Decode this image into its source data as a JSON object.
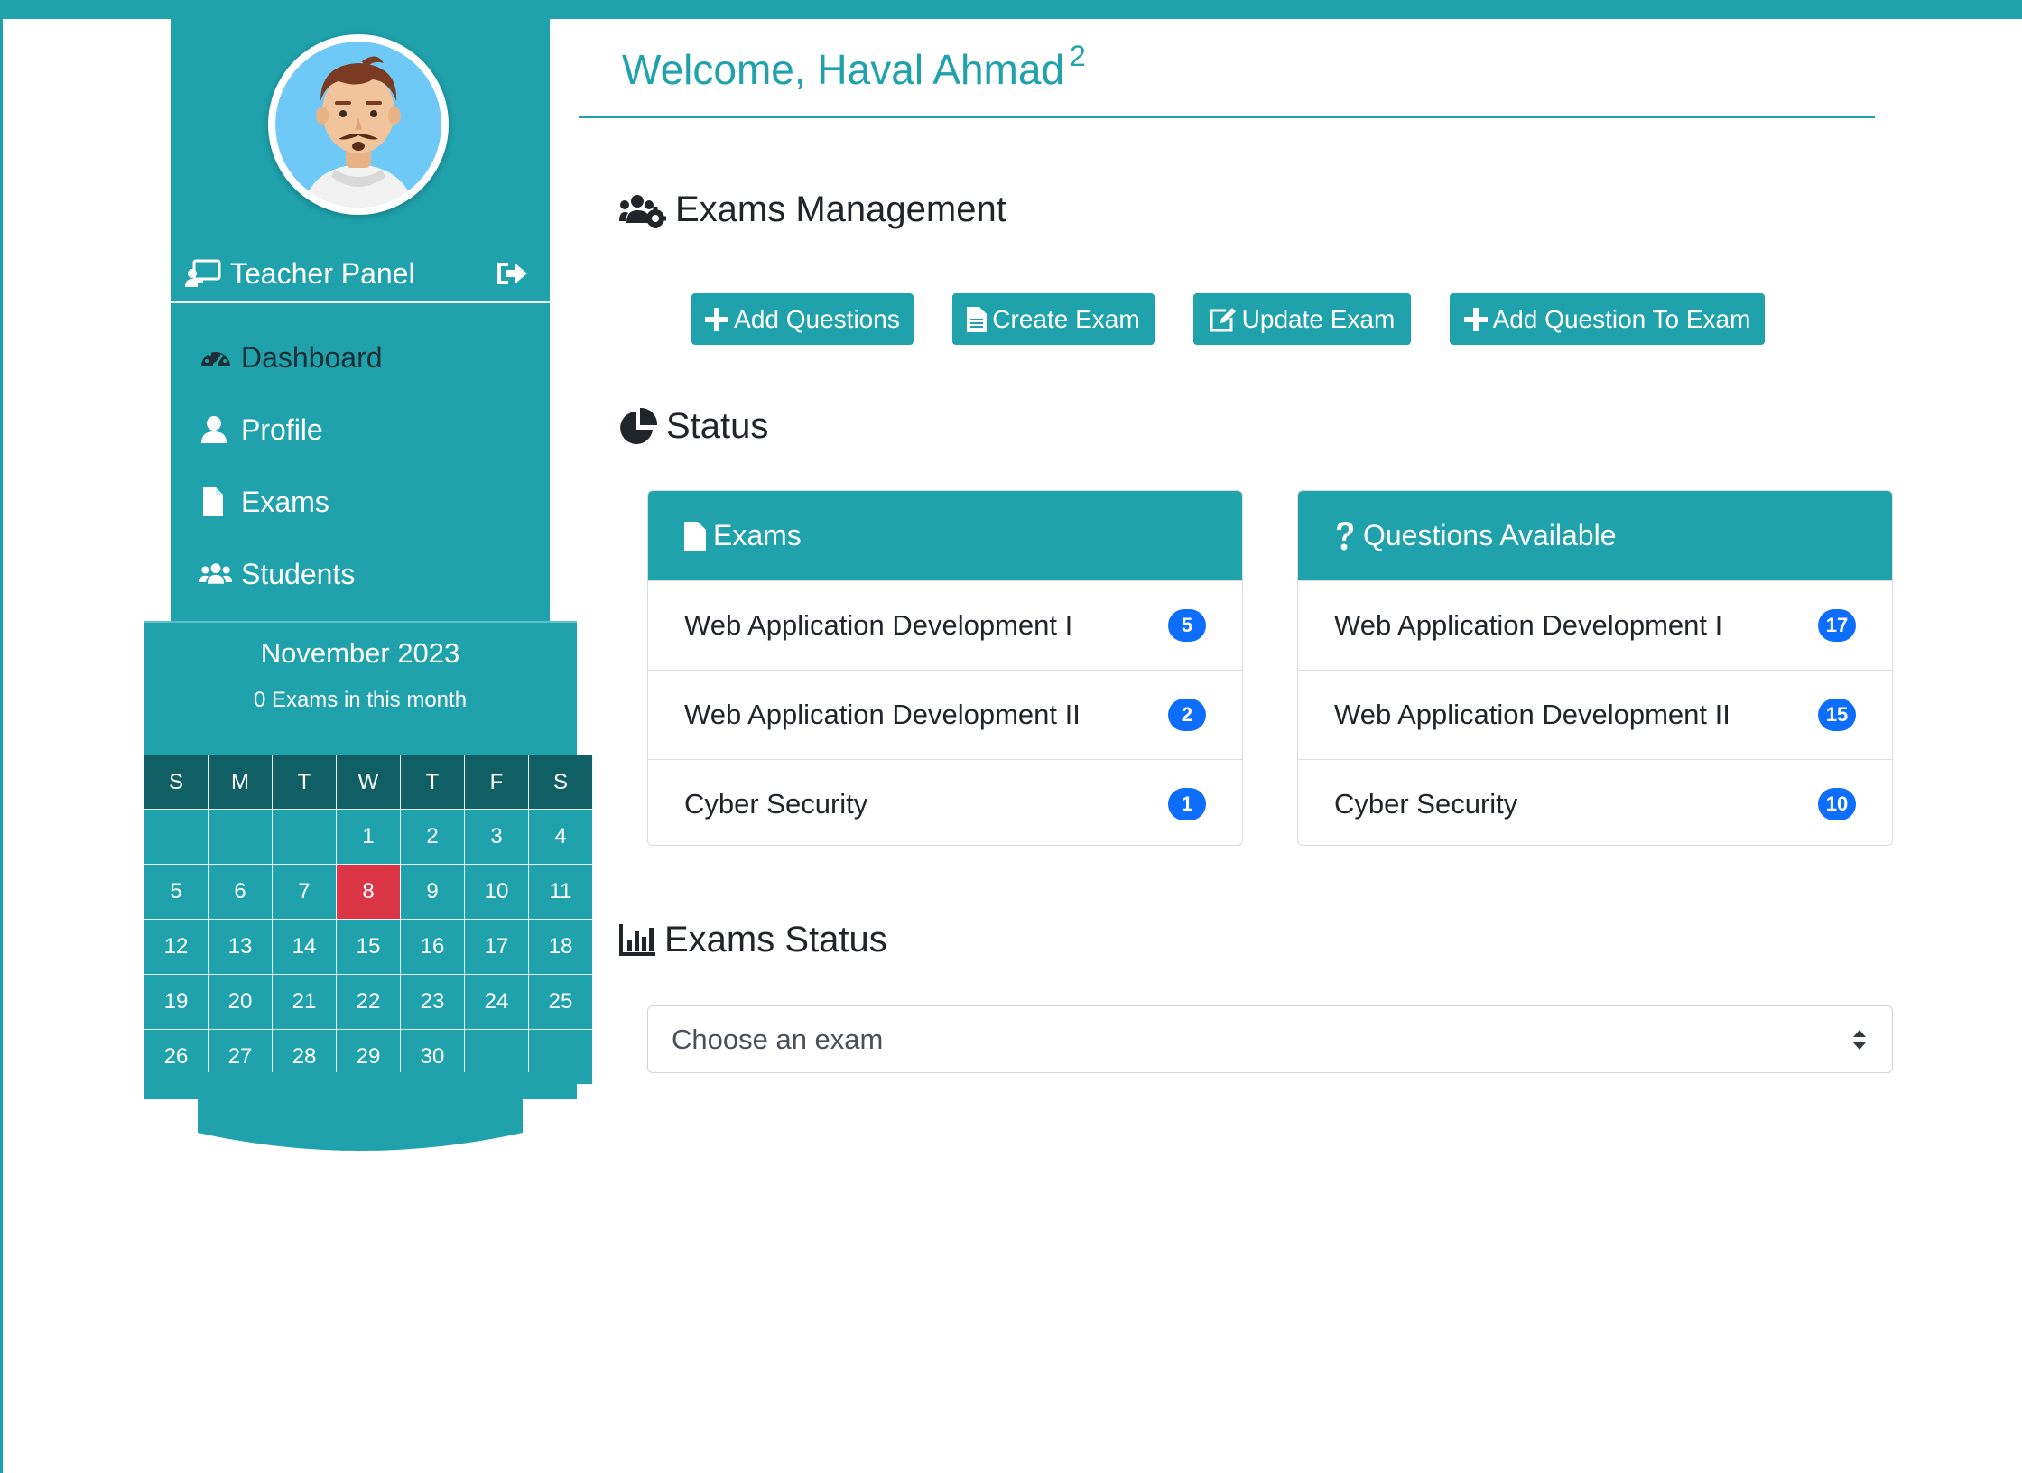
{
  "colors": {
    "accent": "#1fa2ac",
    "calendar_header": "#0f5f64",
    "today": "#dc3545",
    "badge": "#0d6efd"
  },
  "header": {
    "welcome": "Welcome, Haval Ahmad",
    "notification_count": "2"
  },
  "sidebar": {
    "avatar_icon": "user-avatar",
    "title": "Teacher Panel",
    "logout_icon": "sign-out-icon",
    "items": [
      {
        "label": "Dashboard",
        "icon": "tachometer-icon",
        "active": true
      },
      {
        "label": "Profile",
        "icon": "user-icon"
      },
      {
        "label": "Exams",
        "icon": "file-icon"
      },
      {
        "label": "Students",
        "icon": "users-icon"
      }
    ]
  },
  "calendar": {
    "month": "November 2023",
    "summary": "0 Exams in this month",
    "weekdays": [
      "S",
      "M",
      "T",
      "W",
      "T",
      "F",
      "S"
    ],
    "weeks": [
      [
        "",
        "",
        "",
        "1",
        "2",
        "3",
        "4"
      ],
      [
        "5",
        "6",
        "7",
        "8",
        "9",
        "10",
        "11"
      ],
      [
        "12",
        "13",
        "14",
        "15",
        "16",
        "17",
        "18"
      ],
      [
        "19",
        "20",
        "21",
        "22",
        "23",
        "24",
        "25"
      ],
      [
        "26",
        "27",
        "28",
        "29",
        "30",
        "",
        ""
      ]
    ],
    "today": "8"
  },
  "management": {
    "heading": "Exams Management",
    "buttons": [
      {
        "label": "Add Questions",
        "icon": "plus-icon"
      },
      {
        "label": "Create Exam",
        "icon": "file-text-icon"
      },
      {
        "label": "Update Exam",
        "icon": "edit-icon"
      },
      {
        "label": "Add Question To Exam",
        "icon": "plus-icon"
      }
    ]
  },
  "status": {
    "heading": "Status",
    "exams_card": {
      "title": "Exams",
      "items": [
        {
          "name": "Web Application Development I",
          "count": "5"
        },
        {
          "name": "Web Application Development II",
          "count": "2"
        },
        {
          "name": "Cyber Security",
          "count": "1"
        }
      ]
    },
    "questions_card": {
      "title": "Questions Available",
      "items": [
        {
          "name": "Web Application Development I",
          "count": "17"
        },
        {
          "name": "Web Application Development II",
          "count": "15"
        },
        {
          "name": "Cyber Security",
          "count": "10"
        }
      ]
    }
  },
  "exams_status": {
    "heading": "Exams Status",
    "select_value": "Choose an exam"
  }
}
